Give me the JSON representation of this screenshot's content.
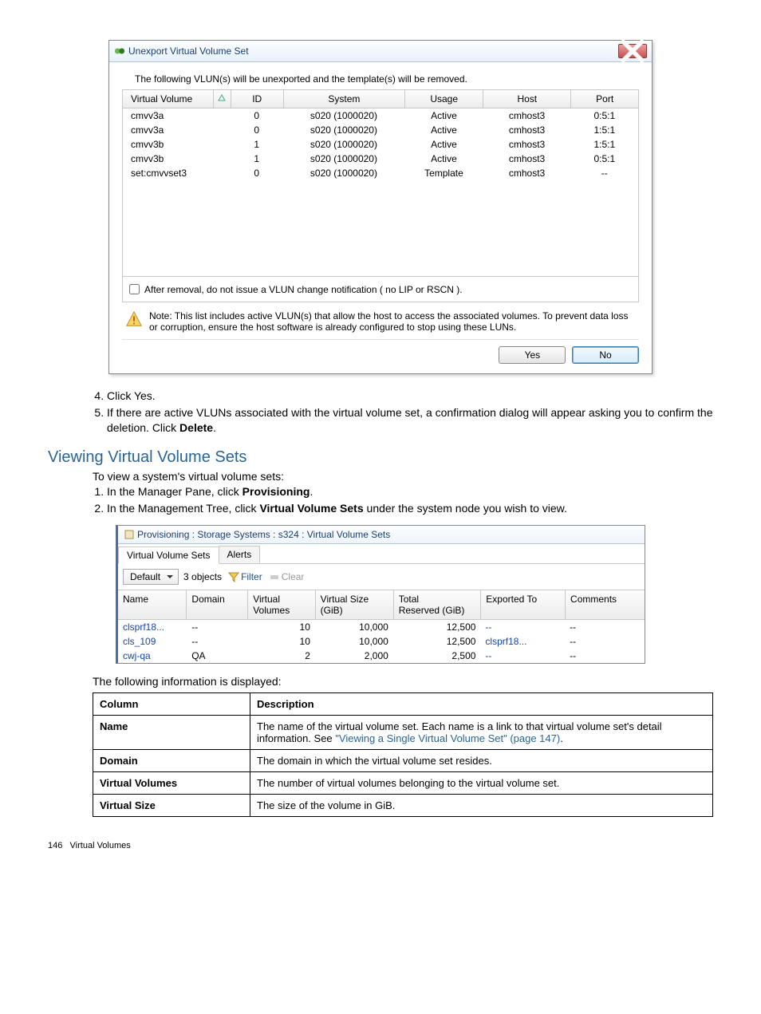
{
  "dialog": {
    "title": "Unexport Virtual Volume Set",
    "intro": "The following VLUN(s) will be unexported and the template(s) will be removed.",
    "columns": {
      "vv": "Virtual Volume",
      "id": "ID",
      "system": "System",
      "usage": "Usage",
      "host": "Host",
      "port": "Port"
    },
    "rows": [
      {
        "vv": "cmvv3a",
        "id": "0",
        "system": "s020 (1000020)",
        "usage": "Active",
        "host": "cmhost3",
        "port": "0:5:1"
      },
      {
        "vv": "cmvv3a",
        "id": "0",
        "system": "s020 (1000020)",
        "usage": "Active",
        "host": "cmhost3",
        "port": "1:5:1"
      },
      {
        "vv": "cmvv3b",
        "id": "1",
        "system": "s020 (1000020)",
        "usage": "Active",
        "host": "cmhost3",
        "port": "1:5:1"
      },
      {
        "vv": "cmvv3b",
        "id": "1",
        "system": "s020 (1000020)",
        "usage": "Active",
        "host": "cmhost3",
        "port": "0:5:1"
      },
      {
        "vv": "set:cmvvset3",
        "id": "0",
        "system": "s020 (1000020)",
        "usage": "Template",
        "host": "cmhost3",
        "port": "--"
      }
    ],
    "checkbox_label": "After removal, do not issue a VLUN change notification ( no LIP or RSCN ).",
    "note": "Note: This list includes active VLUN(s) that allow the host to access the associated volumes. To prevent data loss or corruption, ensure the host software is already configured to stop using these LUNs.",
    "yes": "Yes",
    "no": "No"
  },
  "steps": {
    "s4": "Click Yes.",
    "s5_a": "If there are active VLUNs associated with the virtual volume set, a confirmation dialog will appear asking you to confirm the deletion. Click ",
    "s5_b": "Delete",
    "s5_c": "."
  },
  "section_heading": "Viewing Virtual Volume Sets",
  "section_intro": "To view a system's virtual volume sets:",
  "view_steps": {
    "s1_a": "In the Manager Pane, click ",
    "s1_b": "Provisioning",
    "s1_c": ".",
    "s2_a": "In the Management Tree, click ",
    "s2_b": "Virtual Volume Sets",
    "s2_c": " under the system node you wish to view."
  },
  "panel": {
    "title": "Provisioning : Storage Systems : s324 : Virtual Volume Sets",
    "tab1": "Virtual Volume Sets",
    "tab2": "Alerts",
    "default_label": "Default",
    "objcount": "3 objects",
    "filter": "Filter",
    "clear": "Clear",
    "cols": {
      "name": "Name",
      "domain": "Domain",
      "vv": "Virtual\nVolumes",
      "vs": "Virtual Size\n(GiB)",
      "tr": "Total\nReserved (GiB)",
      "ex": "Exported To",
      "com": "Comments"
    },
    "rows": [
      {
        "name": "clsprf18...",
        "domain": "--",
        "vv": "10",
        "vs": "10,000",
        "tr": "12,500",
        "ex": "--",
        "com": "--"
      },
      {
        "name": "cls_109",
        "domain": "--",
        "vv": "10",
        "vs": "10,000",
        "tr": "12,500",
        "ex": "clsprf18...",
        "com": "--"
      },
      {
        "name": "cwj-qa",
        "domain": "QA",
        "vv": "2",
        "vs": "2,000",
        "tr": "2,500",
        "ex": "--",
        "com": "--"
      }
    ]
  },
  "info_label": "The following information is displayed:",
  "desc": {
    "h1": "Column",
    "h2": "Description",
    "r1c": "Name",
    "r1d_a": "The name of the virtual volume set. Each name is a link to that virtual volume set's detail information. See ",
    "r1d_link": "\"Viewing a Single Virtual Volume Set\" (page 147)",
    "r1d_b": ".",
    "r2c": "Domain",
    "r2d": "The domain in which the virtual volume set resides.",
    "r3c": "Virtual Volumes",
    "r3d": "The number of virtual volumes belonging to the virtual volume set.",
    "r4c": "Virtual Size",
    "r4d": "The size of the volume in GiB."
  },
  "footer_page": "146",
  "footer_label": "Virtual Volumes"
}
